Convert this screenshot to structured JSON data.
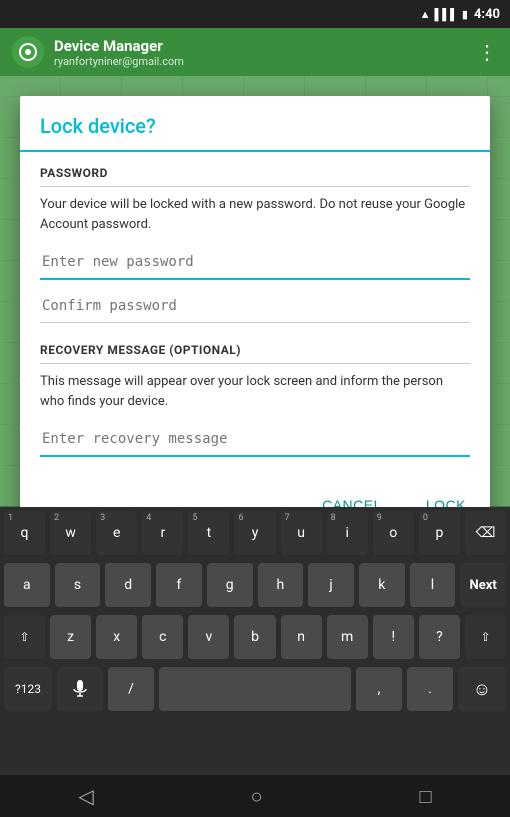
{
  "statusBar": {
    "time": "4:40",
    "icons": [
      "wifi",
      "signal",
      "battery"
    ]
  },
  "appBar": {
    "title": "Device Manager",
    "subtitle": "ryanfortyniner@gmail.com",
    "iconLabel": "device-manager-icon"
  },
  "dialog": {
    "title": "Lock device?",
    "passwordSection": {
      "label": "PASSWORD",
      "description": "Your device will be locked with a new password. Do not reuse your Google Account password.",
      "newPasswordPlaceholder": "Enter new password",
      "confirmPasswordPlaceholder": "Confirm password"
    },
    "recoverySection": {
      "label": "RECOVERY MESSAGE (OPTIONAL)",
      "description": "This message will appear over your lock screen and inform the person who finds your device.",
      "placeholder": "Enter recovery message"
    },
    "cancelLabel": "Cancel",
    "lockLabel": "Lock"
  },
  "keyboard": {
    "rows": [
      [
        "q",
        "w",
        "e",
        "r",
        "t",
        "y",
        "u",
        "i",
        "o",
        "p"
      ],
      [
        "a",
        "s",
        "d",
        "f",
        "g",
        "h",
        "j",
        "k",
        "l"
      ],
      [
        "shift",
        "z",
        "x",
        "c",
        "v",
        "b",
        "n",
        "m",
        "!",
        "?",
        "shift2"
      ],
      [
        "?123",
        "mic",
        "/",
        "space",
        ",",
        ".",
        "emoji"
      ]
    ],
    "numbers": [
      "1",
      "2",
      "3",
      "4",
      "5",
      "6",
      "7",
      "8",
      "9",
      "0"
    ],
    "nextLabel": "Next",
    "backspaceLabel": "⌫",
    "dotdotdot": "..."
  },
  "navBar": {
    "backIcon": "◁",
    "homeIcon": "○",
    "recentIcon": "□"
  }
}
